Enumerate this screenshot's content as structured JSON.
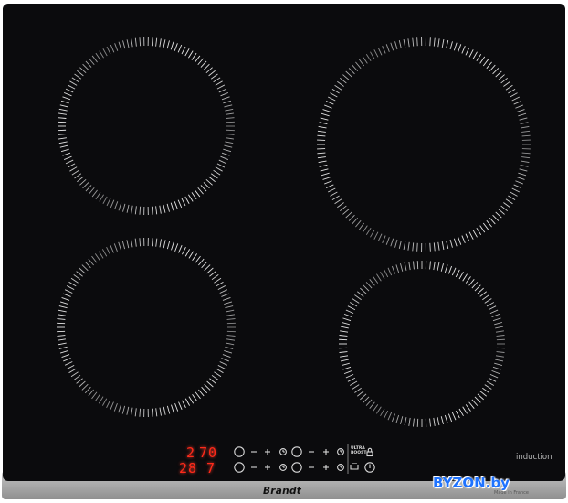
{
  "brand": "Brandt",
  "product_label": "induction",
  "made_in": "Made in France",
  "watermark": "BYZON.by",
  "display": {
    "top_left_digit": "2",
    "top_right_digits": "70",
    "bottom_left_digits": "28",
    "bottom_right_digit": "7"
  },
  "boost_label": "ULTRA BOOST",
  "colors": {
    "glass": "#0b0b0d",
    "frame": "#9a9a9a",
    "display_red": "#ff2a1a",
    "zone_marks": "#e8e8e8"
  },
  "icons": {
    "zone_select": "power-ring-icon",
    "minus": "minus-icon",
    "plus": "plus-icon",
    "timer": "clock-icon",
    "lock": "lock-icon",
    "pause": "pan-pause-icon",
    "power": "power-icon"
  }
}
